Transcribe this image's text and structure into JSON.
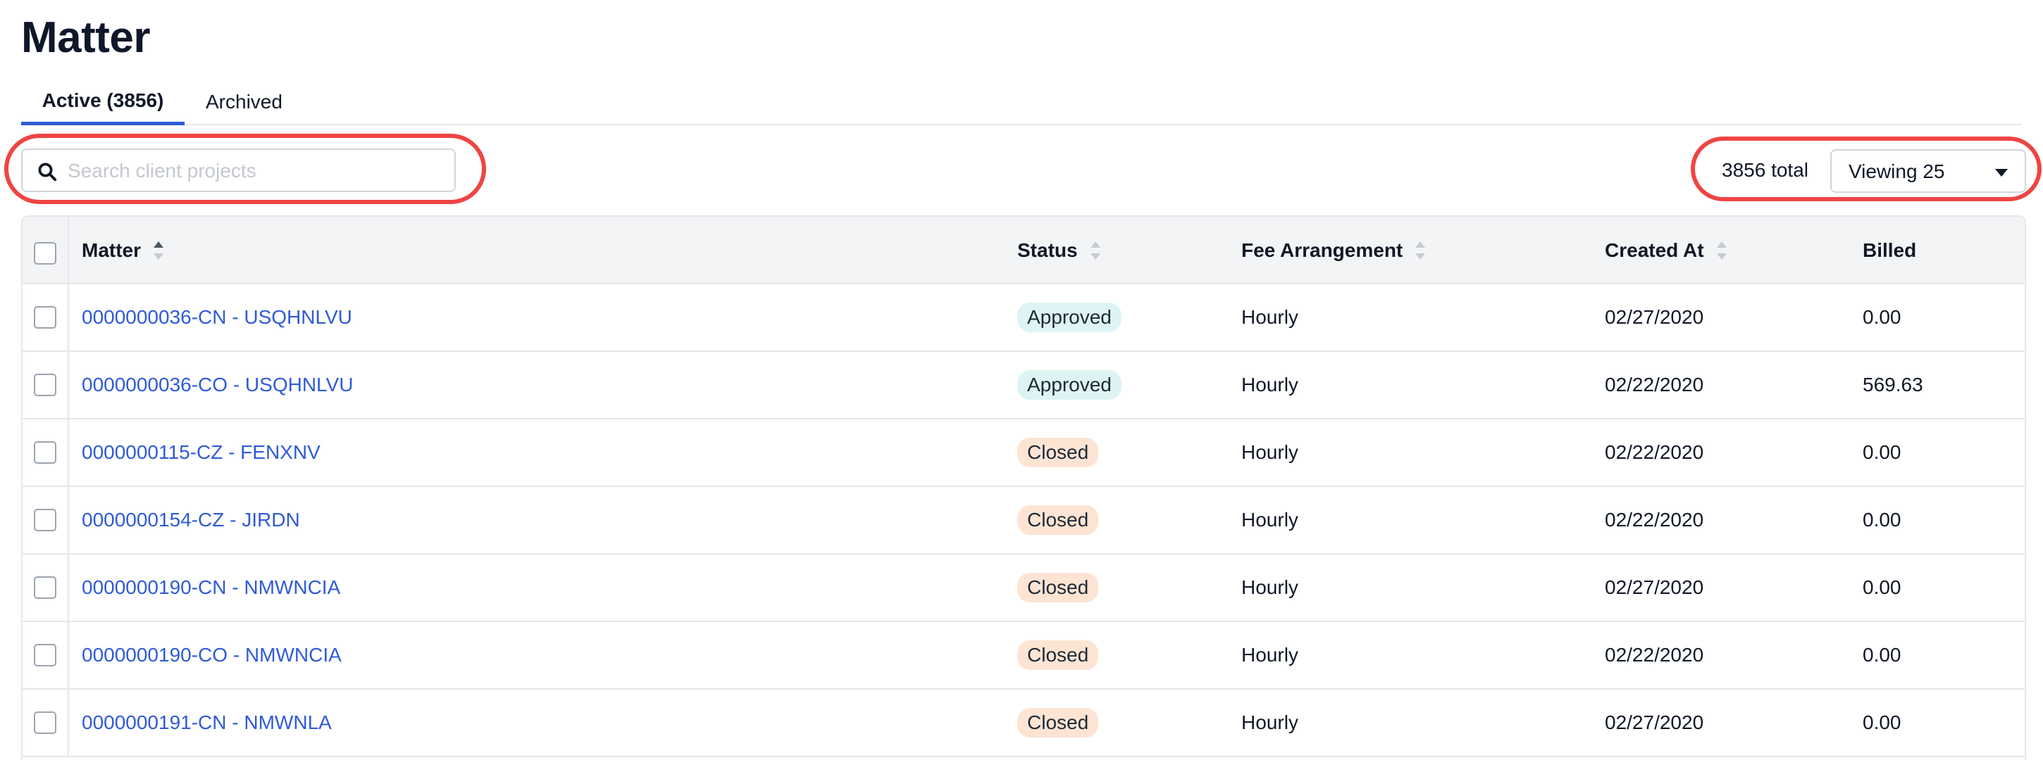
{
  "page": {
    "title": "Matter"
  },
  "tabs": [
    {
      "label": "Active (3856)",
      "active": true
    },
    {
      "label": "Archived",
      "active": false
    }
  ],
  "search": {
    "placeholder": "Search client projects",
    "value": ""
  },
  "pagination": {
    "total_label": "3856 total",
    "viewing_label": "Viewing 25"
  },
  "table": {
    "columns": {
      "matter": "Matter",
      "status": "Status",
      "fee": "Fee Arrangement",
      "created": "Created At",
      "billed": "Billed"
    },
    "rows": [
      {
        "matter": "0000000036-CN - USQHNLVU",
        "status": "Approved",
        "fee": "Hourly",
        "created": "02/27/2020",
        "billed": "0.00"
      },
      {
        "matter": "0000000036-CO - USQHNLVU",
        "status": "Approved",
        "fee": "Hourly",
        "created": "02/22/2020",
        "billed": "569.63"
      },
      {
        "matter": "0000000115-CZ - FENXNV",
        "status": "Closed",
        "fee": "Hourly",
        "created": "02/22/2020",
        "billed": "0.00"
      },
      {
        "matter": "0000000154-CZ - JIRDN",
        "status": "Closed",
        "fee": "Hourly",
        "created": "02/22/2020",
        "billed": "0.00"
      },
      {
        "matter": "0000000190-CN - NMWNCIA",
        "status": "Closed",
        "fee": "Hourly",
        "created": "02/27/2020",
        "billed": "0.00"
      },
      {
        "matter": "0000000190-CO - NMWNCIA",
        "status": "Closed",
        "fee": "Hourly",
        "created": "02/22/2020",
        "billed": "0.00"
      },
      {
        "matter": "0000000191-CN - NMWNLA",
        "status": "Closed",
        "fee": "Hourly",
        "created": "02/27/2020",
        "billed": "0.00"
      }
    ]
  },
  "colors": {
    "accent": "#2f5bd7",
    "approved_badge": "#def4f4",
    "closed_badge": "#fde4d3",
    "annotation": "#ef4444"
  }
}
